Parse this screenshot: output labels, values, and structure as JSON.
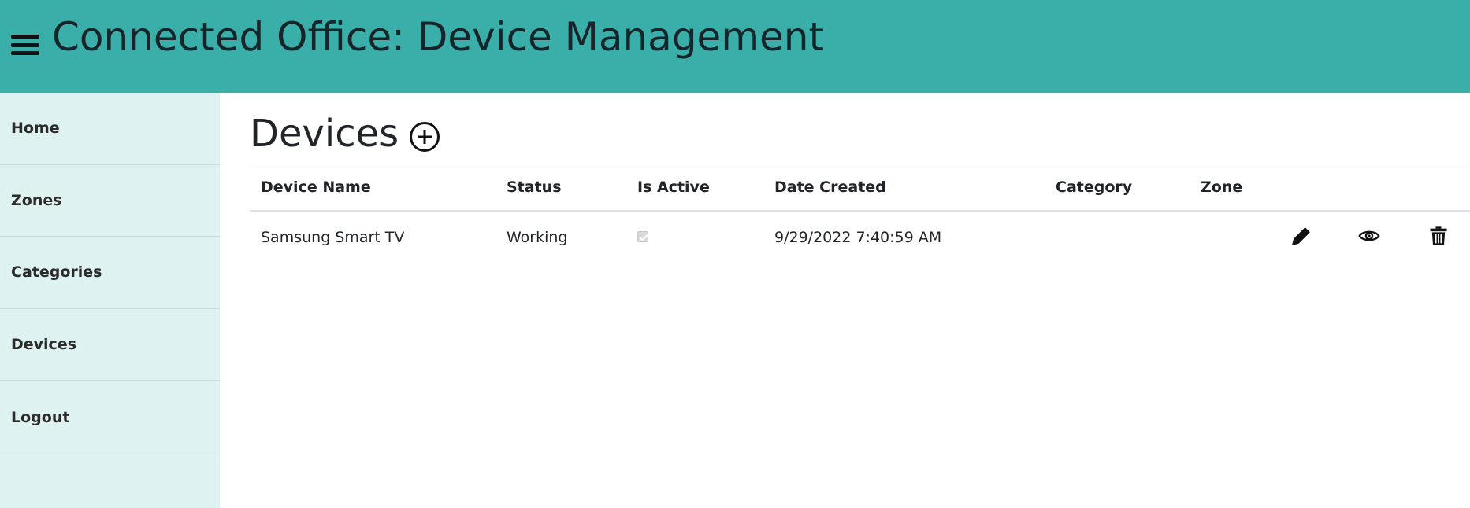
{
  "header": {
    "title": "Connected Office: Device Management",
    "menu_icon": "hamburger-icon",
    "background": "#3aafa9"
  },
  "sidebar": {
    "background": "#def2f1",
    "items": [
      {
        "label": "Home"
      },
      {
        "label": "Zones"
      },
      {
        "label": "Categories"
      },
      {
        "label": "Devices"
      },
      {
        "label": "Logout"
      }
    ]
  },
  "main": {
    "title": "Devices",
    "add_icon": "plus-circle-icon",
    "table": {
      "headers": [
        "Device Name",
        "Status",
        "Is Active",
        "Date Created",
        "Category",
        "Zone"
      ],
      "rows": [
        {
          "device_name": "Samsung Smart TV",
          "status": "Working",
          "is_active": true,
          "date_created": "9/29/2022 7:40:59 AM",
          "category": "",
          "zone": "",
          "actions": [
            "pencil-icon",
            "eye-icon",
            "trash-icon"
          ]
        }
      ]
    }
  }
}
